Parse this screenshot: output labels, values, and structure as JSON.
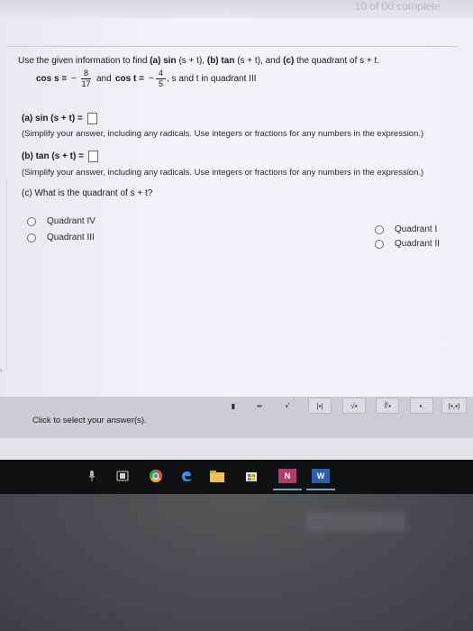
{
  "header": {
    "progress_text": "10 of 00 complete"
  },
  "problem": {
    "intro": "Use the given information to find",
    "part_a_label": "(a)",
    "part_a_expr": "sin",
    "part_a_arg": "(s + t),",
    "part_b_label": "(b)",
    "part_b_expr": "tan",
    "part_b_arg": "(s + t), and",
    "part_c_label": "(c)",
    "part_c_text": "the quadrant of s + t."
  },
  "given": {
    "cos_s_label": "cos s =",
    "minus": "−",
    "cos_s_num": "8",
    "cos_s_den": "17",
    "and_text": "and",
    "cos_t_label": "cos t =",
    "cos_t_num": "4",
    "cos_t_den": "5",
    "tail": ", s and t in quadrant III"
  },
  "part_a": {
    "label": "(a)",
    "expr": "sin (s + t) =",
    "hint": "(Simplify your answer, including any radicals. Use integers or fractions for any numbers in the expression.)"
  },
  "part_b": {
    "label": "(b)",
    "expr": "tan (s + t) =",
    "hint": "(Simplify your answer, including any radicals. Use integers or fractions for any numbers in the expression.)"
  },
  "part_c": {
    "question": "(c) What is the quadrant of s + t?",
    "options": [
      "Quadrant IV",
      "Quadrant III",
      "Quadrant I",
      "Quadrant II"
    ]
  },
  "toolbar": {
    "tools": [
      "▮",
      "▪▪",
      "▪'",
      "|▪|",
      "√▪",
      "∛▪",
      "▪.",
      "(▪,▪)"
    ]
  },
  "footer": {
    "message": "Click to select your answer(s)."
  },
  "taskbar": {
    "onenote_label": "N",
    "word_label": "W"
  }
}
